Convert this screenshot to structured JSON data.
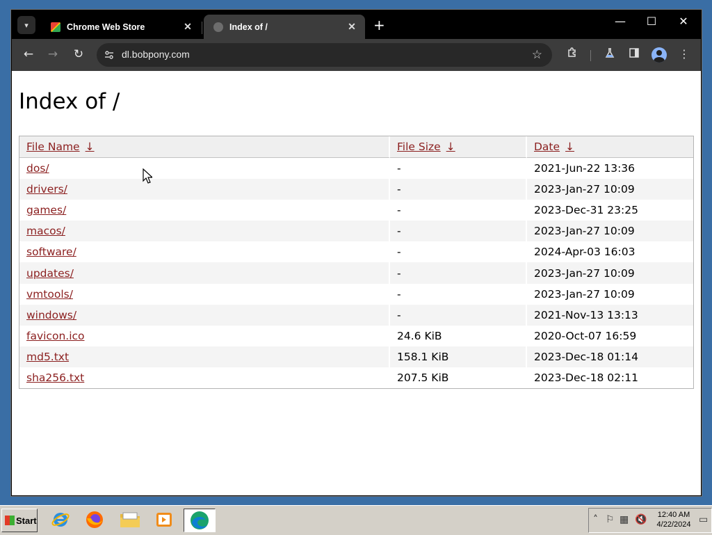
{
  "browser": {
    "tabs": [
      {
        "title": "Chrome Web Store",
        "close": "✕"
      },
      {
        "title": "Index of /",
        "close": "✕"
      }
    ],
    "new_tab": "+",
    "controls": {
      "minimize": "—",
      "maximize": "☐",
      "close": "✕"
    },
    "nav": {
      "back": "←",
      "forward": "→",
      "reload": "↻"
    },
    "url": "dl.bobpony.com",
    "icons": {
      "tab_search": "chevron-down-icon",
      "site_info": "tune-icon",
      "bookmark": "star-icon",
      "extensions": "puzzle-icon",
      "labs": "flask-icon",
      "side_panel": "side-panel-icon",
      "profile": "avatar-icon",
      "menu": "kebab-menu-icon"
    }
  },
  "page": {
    "heading": "Index of /",
    "columns": [
      {
        "label": "File Name",
        "sort": "↓"
      },
      {
        "label": "File Size",
        "sort": "↓"
      },
      {
        "label": "Date",
        "sort": "↓"
      }
    ],
    "rows": [
      {
        "name": "dos/",
        "size": "-",
        "date": "2021-Jun-22 13:36"
      },
      {
        "name": "drivers/",
        "size": "-",
        "date": "2023-Jan-27 10:09"
      },
      {
        "name": "games/",
        "size": "-",
        "date": "2023-Dec-31 23:25"
      },
      {
        "name": "macos/",
        "size": "-",
        "date": "2023-Jan-27 10:09"
      },
      {
        "name": "software/",
        "size": "-",
        "date": "2024-Apr-03 16:03"
      },
      {
        "name": "updates/",
        "size": "-",
        "date": "2023-Jan-27 10:09"
      },
      {
        "name": "vmtools/",
        "size": "-",
        "date": "2023-Jan-27 10:09"
      },
      {
        "name": "windows/",
        "size": "-",
        "date": "2021-Nov-13 13:13"
      },
      {
        "name": "favicon.ico",
        "size": "24.6 KiB",
        "date": "2020-Oct-07 16:59"
      },
      {
        "name": "md5.txt",
        "size": "158.1 KiB",
        "date": "2023-Dec-18 01:14"
      },
      {
        "name": "sha256.txt",
        "size": "207.5 KiB",
        "date": "2023-Dec-18 02:11"
      }
    ]
  },
  "taskbar": {
    "start_label": "Start",
    "apps": [
      "internet-explorer-icon",
      "firefox-icon",
      "file-explorer-icon",
      "media-player-icon",
      "edge-icon"
    ],
    "clock": {
      "time": "12:40 AM",
      "date": "4/22/2024"
    }
  },
  "colors": {
    "link": "#8b1f1f",
    "titlebar": "#000000",
    "toolbar": "#3c3c3c",
    "taskbar": "#d4d0c8",
    "desktop": "#3a6ea5"
  }
}
